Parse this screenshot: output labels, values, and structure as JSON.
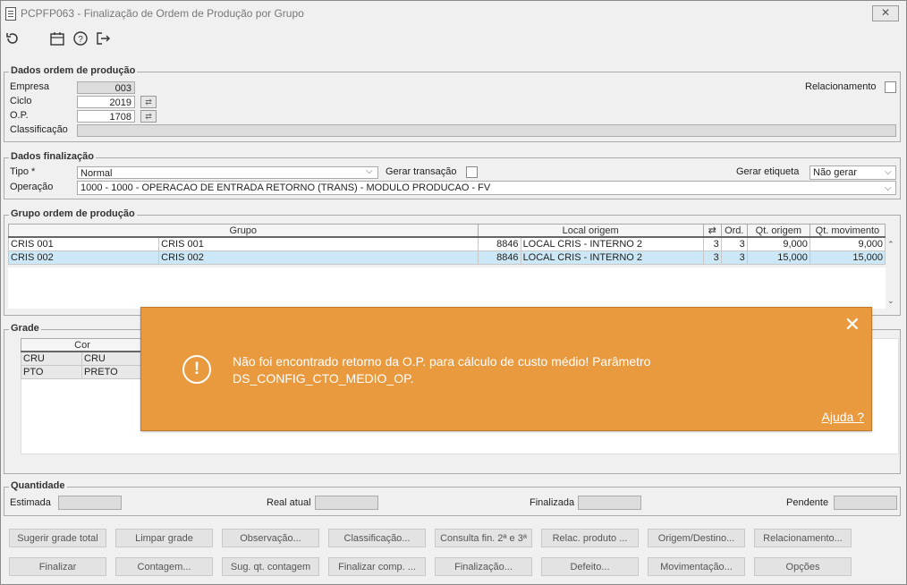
{
  "window": {
    "title": "PCPFP063 - Finalização de Ordem de Produção por Grupo",
    "close_icon": "close-icon"
  },
  "toolbar": {
    "icons": [
      "undo-icon",
      "calendar-icon",
      "help-icon",
      "exit-icon"
    ]
  },
  "dados_op": {
    "legend": "Dados ordem de produção",
    "empresa_label": "Empresa",
    "empresa_value": "003",
    "ciclo_label": "Ciclo",
    "ciclo_value": "2019",
    "op_label": "O.P.",
    "op_value": "1708",
    "classificacao_label": "Classificação",
    "relacionamento_label": "Relacionamento"
  },
  "dados_finalizacao": {
    "legend": "Dados finalização",
    "tipo_label": "Tipo *",
    "tipo_value": "Normal",
    "gerar_transacao_label": "Gerar transação",
    "gerar_etiqueta_label": "Gerar etiqueta",
    "gerar_etiqueta_value": "Não gerar",
    "operacao_label": "Operação",
    "operacao_value": "1000 - 1000 - OPERACAO DE ENTRADA RETORNO  (TRANS) - MODULO PRODUCAO - FV"
  },
  "grupo_op": {
    "legend": "Grupo ordem de produção",
    "headers": {
      "grupo": "Grupo",
      "local": "Local origem",
      "ord": "Ord.",
      "qt_origem": "Qt. origem",
      "qt_mov": "Qt. movimento"
    },
    "rows": [
      {
        "grupo": "CRIS 001",
        "desc": "CRIS 001",
        "local_cod": "8846",
        "local_nome": "LOCAL CRIS - INTERNO 2",
        "a": "3",
        "ord": "3",
        "qt_origem": "9,000",
        "qt_mov": "9,000"
      },
      {
        "grupo": "CRIS 002",
        "desc": "CRIS 002",
        "local_cod": "8846",
        "local_nome": "LOCAL CRIS - INTERNO 2",
        "a": "3",
        "ord": "3",
        "qt_origem": "15,000",
        "qt_mov": "15,000"
      }
    ]
  },
  "grade": {
    "legend": "Grade",
    "header_cor": "Cor",
    "rows": [
      {
        "cod": "CRU",
        "nome": "CRU"
      },
      {
        "cod": "PTO",
        "nome": "PRETO"
      }
    ]
  },
  "quantidade": {
    "legend": "Quantidade",
    "estimada_label": "Estimada",
    "real_label": "Real atual",
    "finalizada_label": "Finalizada",
    "pendente_label": "Pendente"
  },
  "buttons_row1": [
    "Sugerir grade total",
    "Limpar grade",
    "Observação...",
    "Classificação...",
    "Consulta fin. 2ª e 3ª",
    "Relac. produto ...",
    "Origem/Destino...",
    "Relacionamento..."
  ],
  "buttons_row2": [
    "Finalizar",
    "Contagem...",
    "Sug. qt. contagem",
    "Finalizar comp. ...",
    "Finalização...",
    "Defeito...",
    "Movimentação...",
    "Opções"
  ],
  "toast": {
    "message": "Não foi encontrado retorno da O.P. para cálculo de custo médio! Parâmetro DS_CONFIG_CTO_MEDIO_OP.",
    "help": "Ajuda ?",
    "icon": "alert-circle-icon"
  },
  "colors": {
    "toast_bg": "#e99a3f",
    "selected_row": "#cce8f6"
  }
}
